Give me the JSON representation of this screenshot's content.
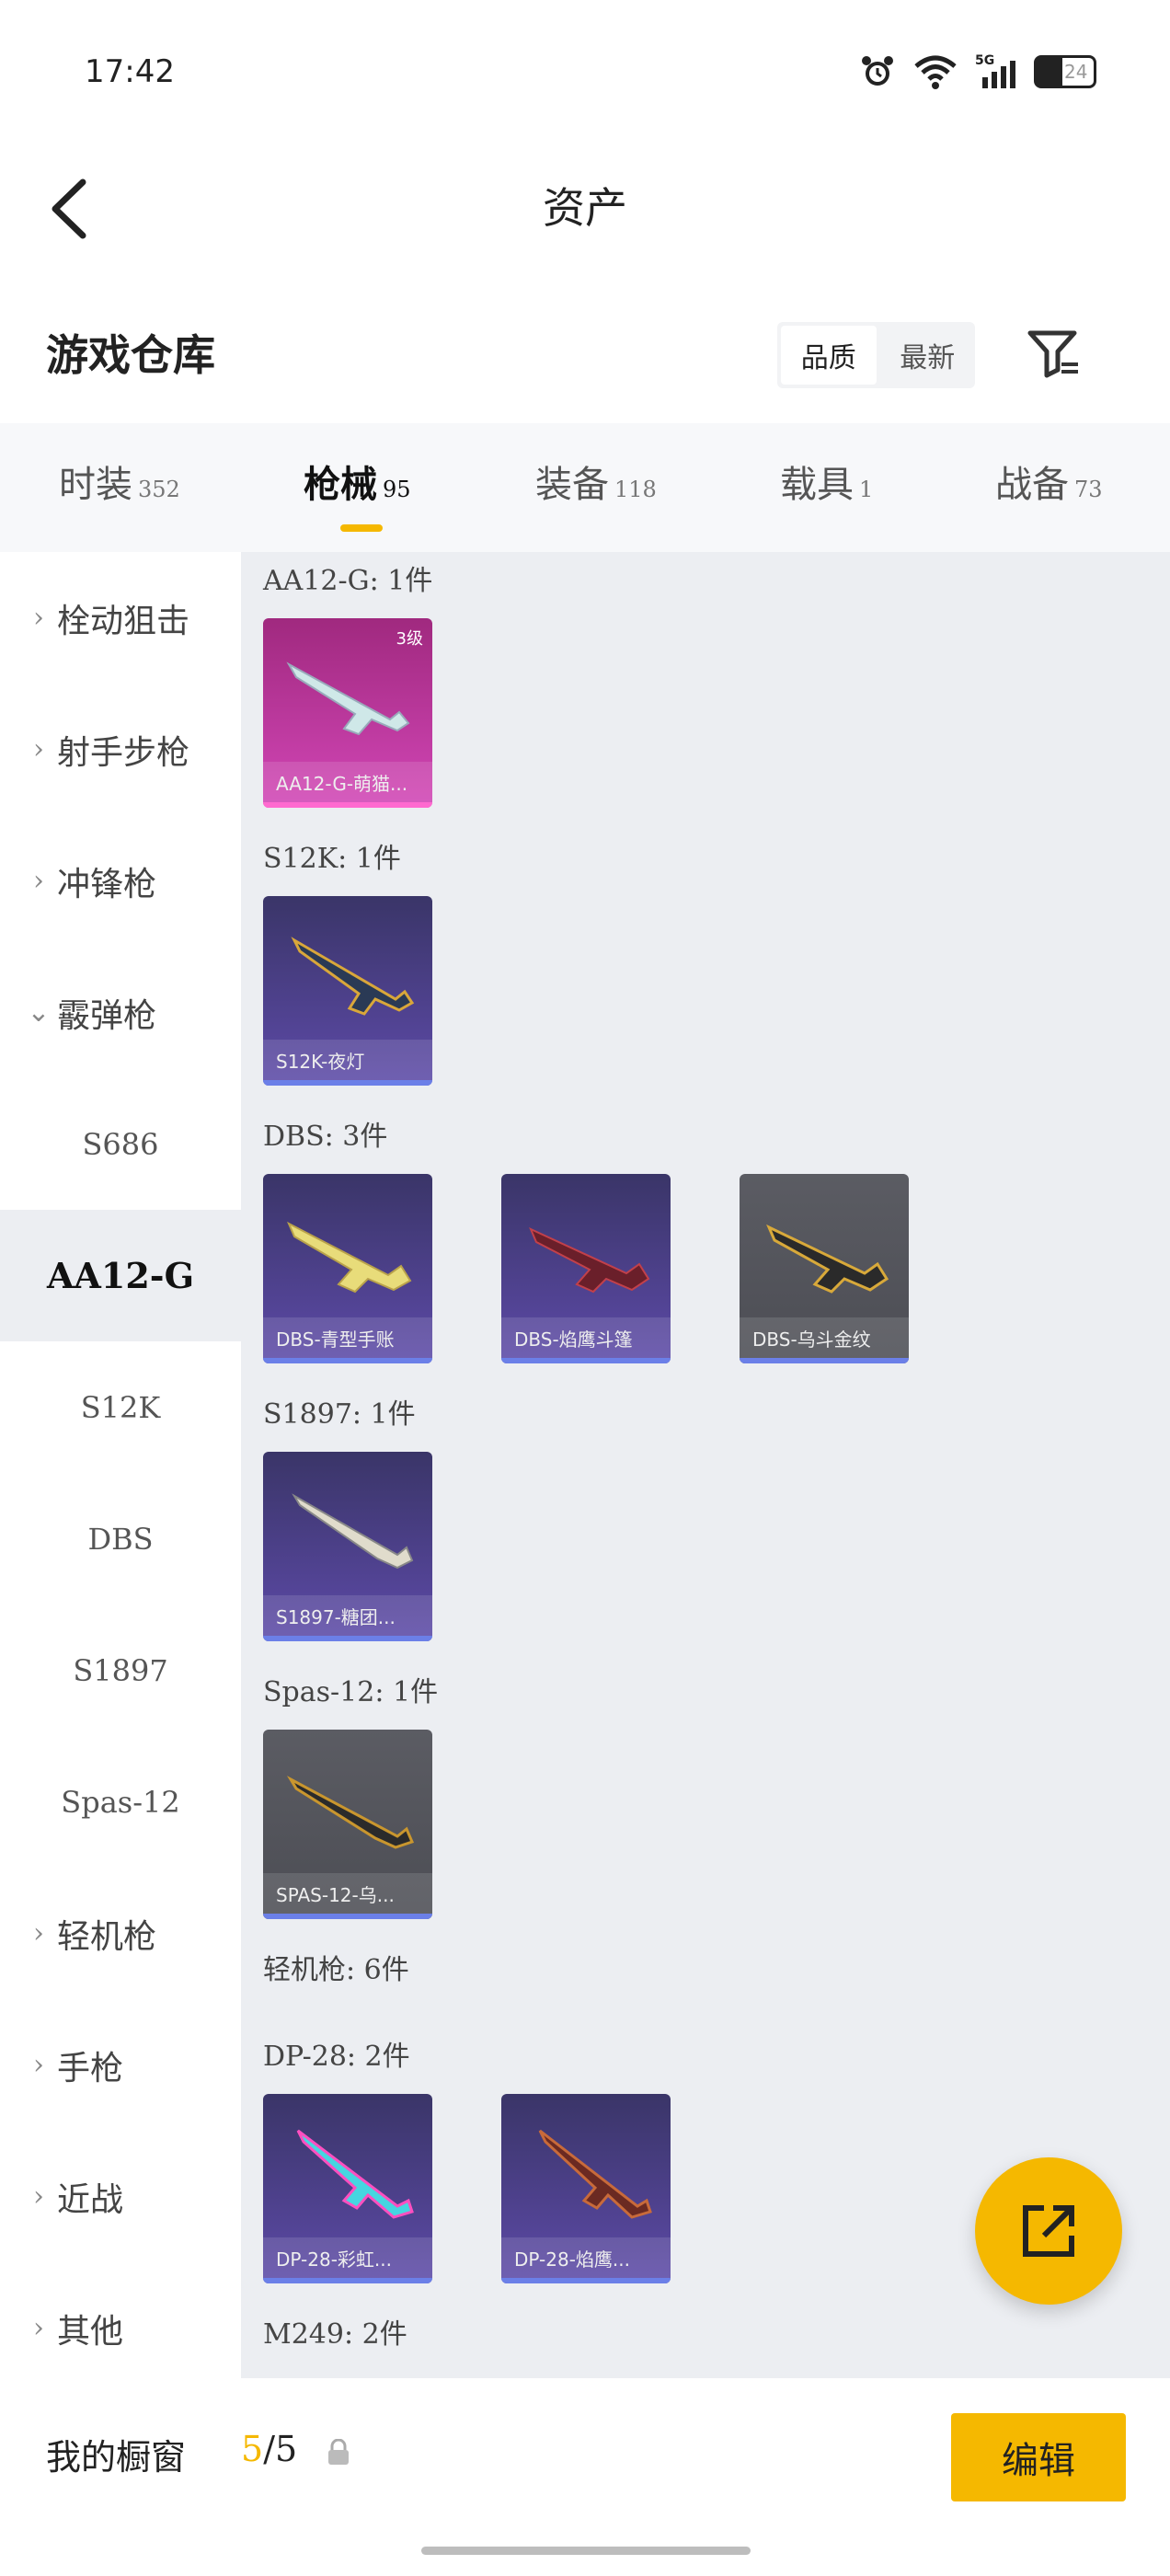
{
  "status_bar": {
    "time": "17:42",
    "battery": "24",
    "signal": "5G"
  },
  "header": {
    "title": "资产",
    "back_label": "<"
  },
  "warehouse": {
    "title": "游戏仓库",
    "sort_options": [
      "品质",
      "最新"
    ]
  },
  "tabs": [
    {
      "label": "时装",
      "count": "352"
    },
    {
      "label": "枪械",
      "count": "95"
    },
    {
      "label": "装备",
      "count": "118"
    },
    {
      "label": "载具",
      "count": "1"
    },
    {
      "label": "战备",
      "count": "73"
    }
  ],
  "sidebar": {
    "items": [
      {
        "label": "栓动狙击",
        "chev": "›"
      },
      {
        "label": "射手步枪",
        "chev": "›"
      },
      {
        "label": "冲锋枪",
        "chev": "›"
      },
      {
        "label": "霰弹枪",
        "chev": "⌄"
      },
      {
        "label": "S686"
      },
      {
        "label": "AA12-G"
      },
      {
        "label": "S12K"
      },
      {
        "label": "DBS"
      },
      {
        "label": "S1897"
      },
      {
        "label": "Spas-12"
      },
      {
        "label": "轻机枪",
        "chev": "›"
      },
      {
        "label": "手枪",
        "chev": "›"
      },
      {
        "label": "近战",
        "chev": "›"
      },
      {
        "label": "其他",
        "chev": "›"
      }
    ]
  },
  "content": {
    "groups": [
      {
        "label": "AA12-G: 1件"
      },
      {
        "label": "S12K: 1件"
      },
      {
        "label": "DBS: 3件"
      },
      {
        "label": "S1897: 1件"
      },
      {
        "label": "Spas-12: 1件"
      },
      {
        "label": "轻机枪: 6件"
      },
      {
        "label": "DP-28: 2件"
      },
      {
        "label": "M249: 2件"
      }
    ],
    "cards": [
      {
        "name": "AA12-G-萌猫...",
        "level": "3级"
      },
      {
        "name": "S12K-夜灯"
      },
      {
        "name": "DBS-青型手账"
      },
      {
        "name": "DBS-焰鹰斗篷"
      },
      {
        "name": "DBS-乌斗金纹"
      },
      {
        "name": "S1897-糖团..."
      },
      {
        "name": "SPAS-12-乌..."
      },
      {
        "name": "DP-28-彩虹..."
      },
      {
        "name": "DP-28-焰鹰..."
      }
    ]
  },
  "showcase": {
    "label": "我的橱窗",
    "current": "5",
    "total": "/5",
    "edit_label": "编辑"
  },
  "colors": {
    "accent": "#f5b800",
    "rare_purple": "#5d4aa8",
    "epic_pink": "#d246b6",
    "gray": "#5b5c63"
  }
}
